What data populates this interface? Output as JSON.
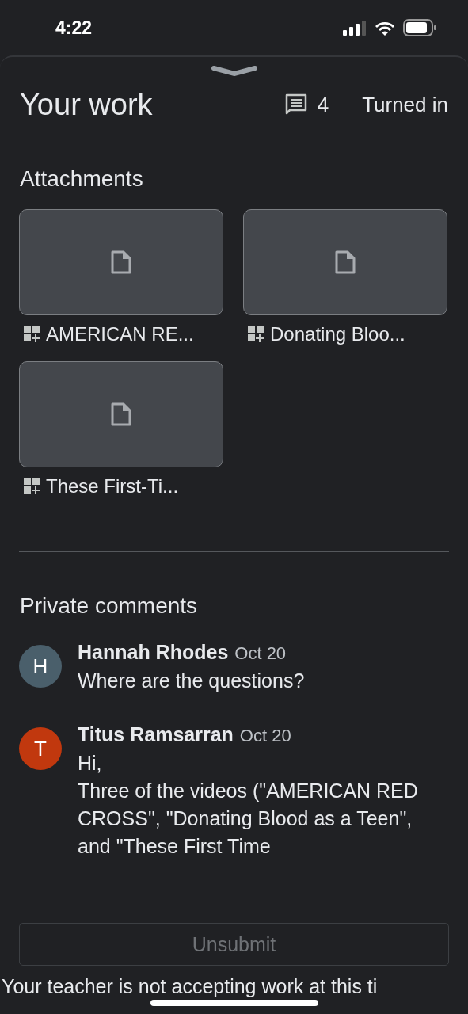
{
  "status_bar": {
    "time": "4:22"
  },
  "header": {
    "title": "Your work",
    "comment_count": "4",
    "status": "Turned in"
  },
  "attachments": {
    "title": "Attachments",
    "items": [
      {
        "name": "AMERICAN RE..."
      },
      {
        "name": "Donating Bloo..."
      },
      {
        "name": "These First-Ti..."
      }
    ]
  },
  "comments": {
    "title": "Private comments",
    "items": [
      {
        "initial": "H",
        "color": "#4a5f6b",
        "author": "Hannah Rhodes",
        "date": "Oct 20",
        "text": "Where are the questions?"
      },
      {
        "initial": "T",
        "color": "#c1380e",
        "author": "Titus Ramsarran",
        "date": "Oct 20",
        "text": "Hi,\nThree of the videos (\"AMERICAN RED CROSS\", \"Donating Blood as a Teen\", and \"These First Time"
      }
    ]
  },
  "footer": {
    "button": {
      "label": "Unsubmit",
      "disabled": true
    },
    "notice": "Your teacher is not accepting work at this ti"
  }
}
